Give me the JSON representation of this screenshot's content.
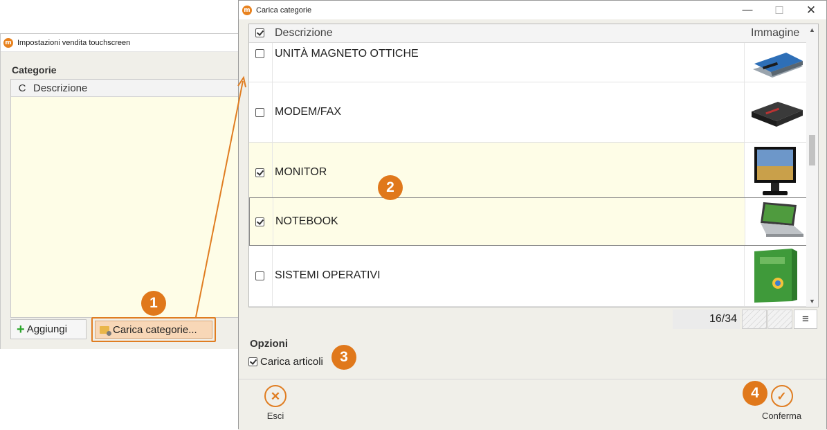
{
  "background_window": {
    "title": "Impostazioni vendita touchscreen",
    "section_label": "Categorie",
    "grid_headers": [
      "C",
      "Descrizione"
    ],
    "add_button": "Aggiungi",
    "load_button": "Carica categorie..."
  },
  "dialog": {
    "title": "Carica categorie",
    "window_controls": {
      "minimize": "—",
      "maximize": "☐",
      "close": "✕"
    },
    "grid": {
      "headers": {
        "description": "Descrizione",
        "image": "Immagine"
      },
      "header_checked": true,
      "rows": [
        {
          "description": "UNITÀ MAGNETO OTTICHE",
          "checked": false,
          "image": "magneto-optical-drive-image"
        },
        {
          "description": "MODEM/FAX",
          "checked": false,
          "image": "modem-image"
        },
        {
          "description": "MONITOR",
          "checked": true,
          "image": "monitor-image"
        },
        {
          "description": "NOTEBOOK",
          "checked": true,
          "image": "notebook-image"
        },
        {
          "description": "SISTEMI OPERATIVI",
          "checked": false,
          "image": "operating-system-box-image"
        }
      ]
    },
    "pager": {
      "label": "16/34",
      "menu_icon": "≡"
    },
    "options": {
      "title": "Opzioni",
      "load_articles_label": "Carica articoli",
      "load_articles_checked": true
    },
    "footer": {
      "exit_label": "Esci",
      "exit_icon": "✕",
      "confirm_label": "Conferma",
      "confirm_icon": "✓"
    }
  },
  "callouts": [
    "1",
    "2",
    "3",
    "4"
  ],
  "colors": {
    "accent": "#e07d21",
    "selected_row": "#fefde7",
    "add_icon": "#2aa52a"
  }
}
